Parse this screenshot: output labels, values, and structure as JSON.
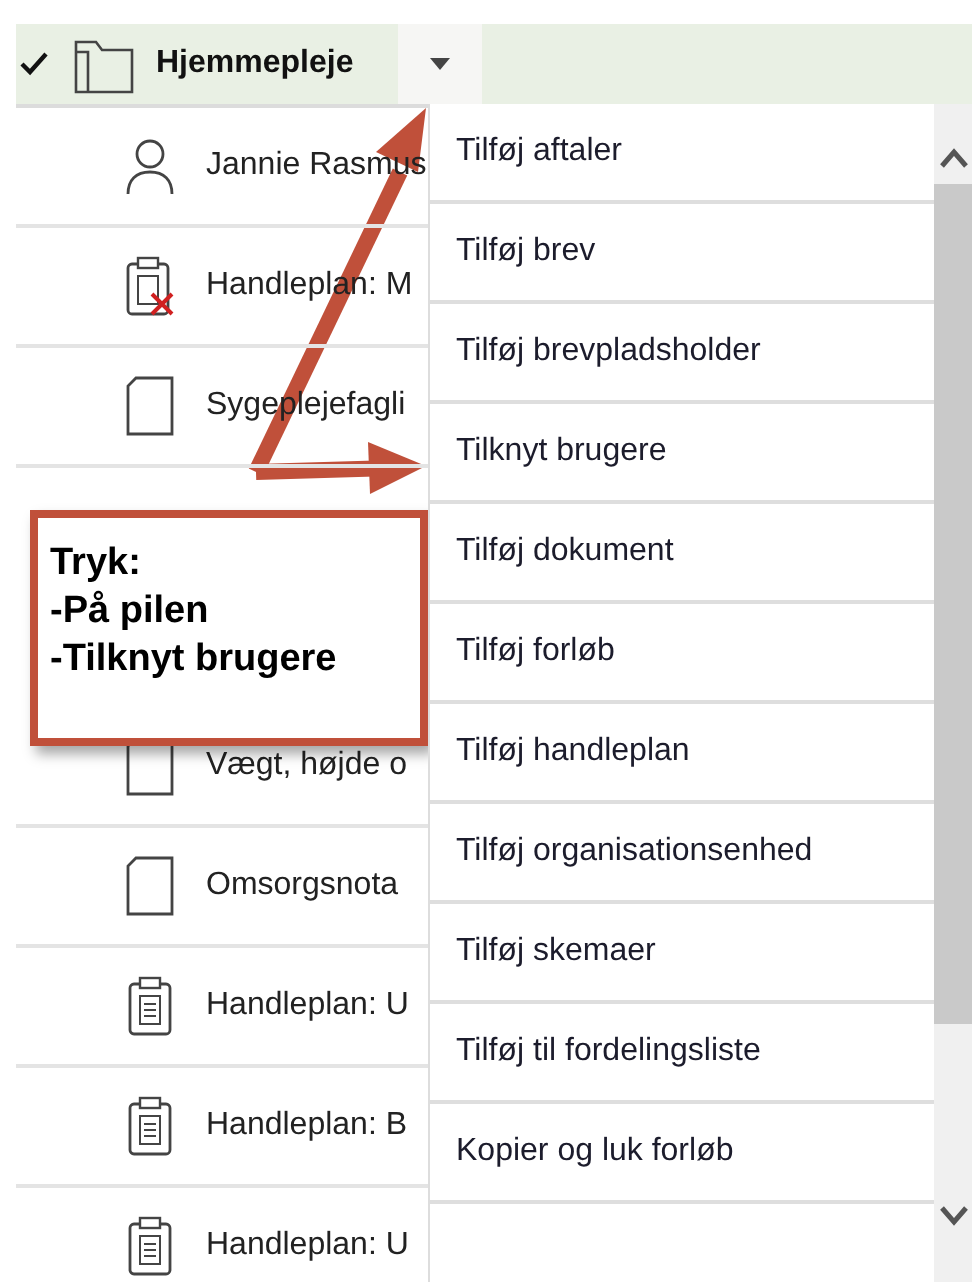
{
  "header": {
    "checked": true,
    "title": "Hjemmepleje"
  },
  "tree_rows": [
    {
      "kind": "person",
      "label": "Jannie Rasmus"
    },
    {
      "kind": "plan-removed",
      "label": "Handleplan: M"
    },
    {
      "kind": "document",
      "label": "Sygeplejefagli"
    },
    {
      "kind": "hidden"
    },
    {
      "kind": "hidden"
    },
    {
      "kind": "document",
      "label": "Vægt, højde o"
    },
    {
      "kind": "document",
      "label": "Omsorgsnota"
    },
    {
      "kind": "plan",
      "label": "Handleplan: U"
    },
    {
      "kind": "plan",
      "label": "Handleplan: B"
    },
    {
      "kind": "plan",
      "label": "Handleplan: U"
    }
  ],
  "menu": {
    "items": [
      "Tilføj aftaler",
      "Tilføj brev",
      "Tilføj brevpladsholder",
      "Tilknyt brugere",
      "Tilføj dokument",
      "Tilføj forløb",
      "Tilføj handleplan",
      "Tilføj organisationsenhed",
      "Tilføj skemaer",
      "Tilføj til fordelingsliste",
      "Kopier og luk forløb"
    ]
  },
  "callout": {
    "lines": [
      "Tryk:",
      "-På pilen",
      "-Tilknyt brugere"
    ]
  }
}
